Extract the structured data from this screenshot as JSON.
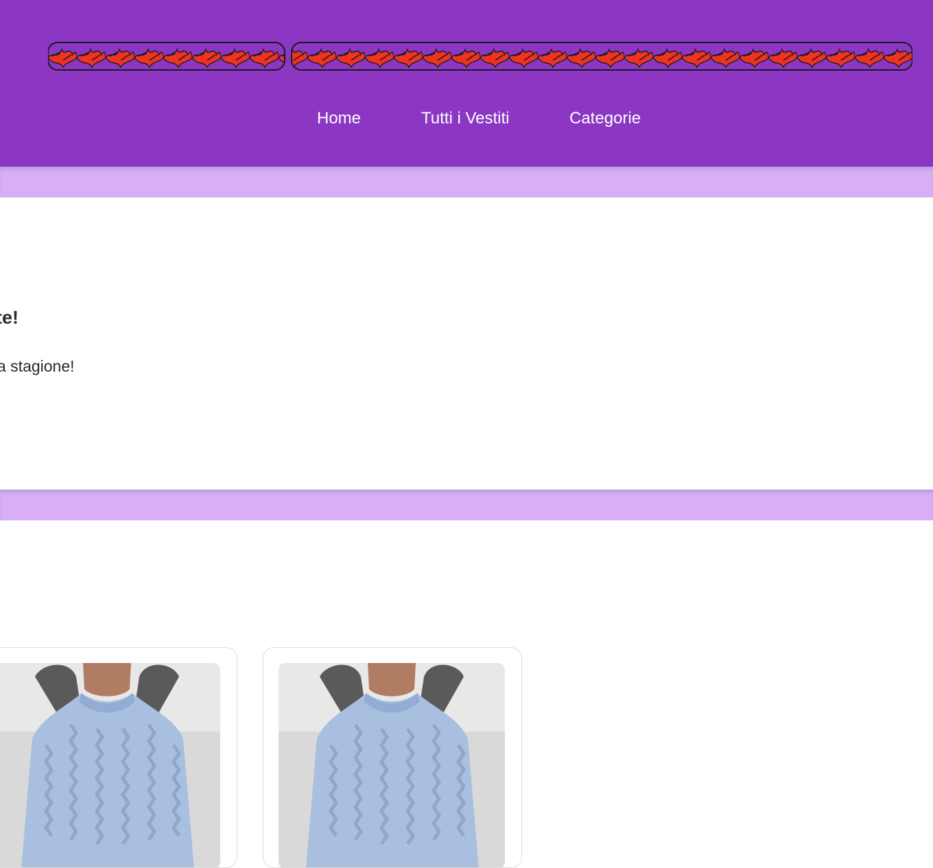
{
  "header": {
    "logo_text": "ERICA ABBIGLIAMENTO",
    "nav": [
      {
        "label": "Home"
      },
      {
        "label": "Tutti i Vestiti"
      },
      {
        "label": "Categorie"
      }
    ]
  },
  "hero": {
    "title": "te!",
    "subtitle": "a stagione!"
  },
  "products": [
    {
      "image": "blue-cable-knit-sweater"
    },
    {
      "image": "blue-cable-knit-sweater"
    }
  ],
  "colors": {
    "header": "#8b37c4",
    "band": "#d8aff7",
    "logo_fill": "#ee3322",
    "nav_text": "#ffffff"
  }
}
